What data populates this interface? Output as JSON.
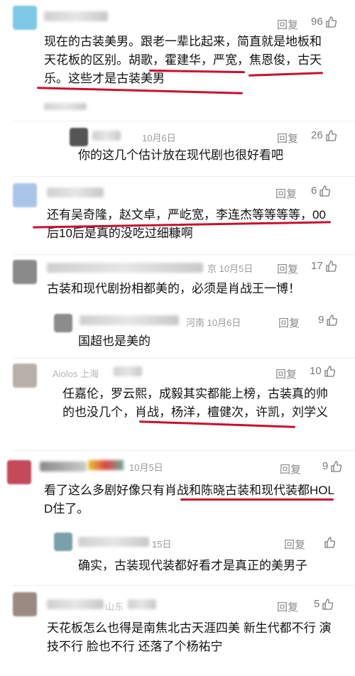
{
  "comments": [
    {
      "reply_label": "回复",
      "likes": "96",
      "text": "现在的古装美男。跟老一辈比起来，简直就是地板和天花板的区别。胡歌，霍建华，严宽，焦恩俊，古天乐。这些才是古装美男"
    },
    {
      "name_partial": "...el",
      "date": "10月6日",
      "reply_label": "回复",
      "likes": "26",
      "text": "你的这几个估计放在现代剧也很好看吧"
    },
    {
      "reply_label": "回复",
      "likes": "6",
      "text": "还有吴奇隆，赵文卓，严屹宽，李连杰等等等等，00后10后是真的没吃过细糠啊"
    },
    {
      "location_date": "京 10月5日",
      "reply_label": "回复",
      "likes": "17",
      "text": "古装和现代剧扮相都美的，必须是肖战王一博！"
    },
    {
      "location_date": "河南  10月6日",
      "reply_label": "回复",
      "likes": "9",
      "text": "国超也是美的"
    },
    {
      "name_partial": "Aiolos  上海",
      "reply_label": "回复",
      "likes": "10",
      "text": "任嘉伦，罗云熙，成毅其实都能上榜，古装真的帅的也没几个，肖战，杨洋，檀健次，许凯，刘学义"
    },
    {
      "date": "10月5日",
      "reply_label": "回复",
      "likes": "9",
      "text": "看了这么多剧好像只有肖战和陈晓古装和现代装都HOLD住了。"
    },
    {
      "date": "15日",
      "reply_label": "回复",
      "likes": "",
      "text": "确实，古装现代装都好看才是真正的美男子"
    },
    {
      "name_partial": "山东",
      "reply_label": "回复",
      "likes": "5",
      "text": "天花板怎么也得是南焦北古天涯四美 新生代都不行 演技不行 脸也不行 还落了个杨祐宁"
    }
  ],
  "colors": {
    "underline": "#c8102e",
    "meta": "#9a9a9a"
  },
  "icons": {
    "like": "thumbs-up-icon"
  }
}
